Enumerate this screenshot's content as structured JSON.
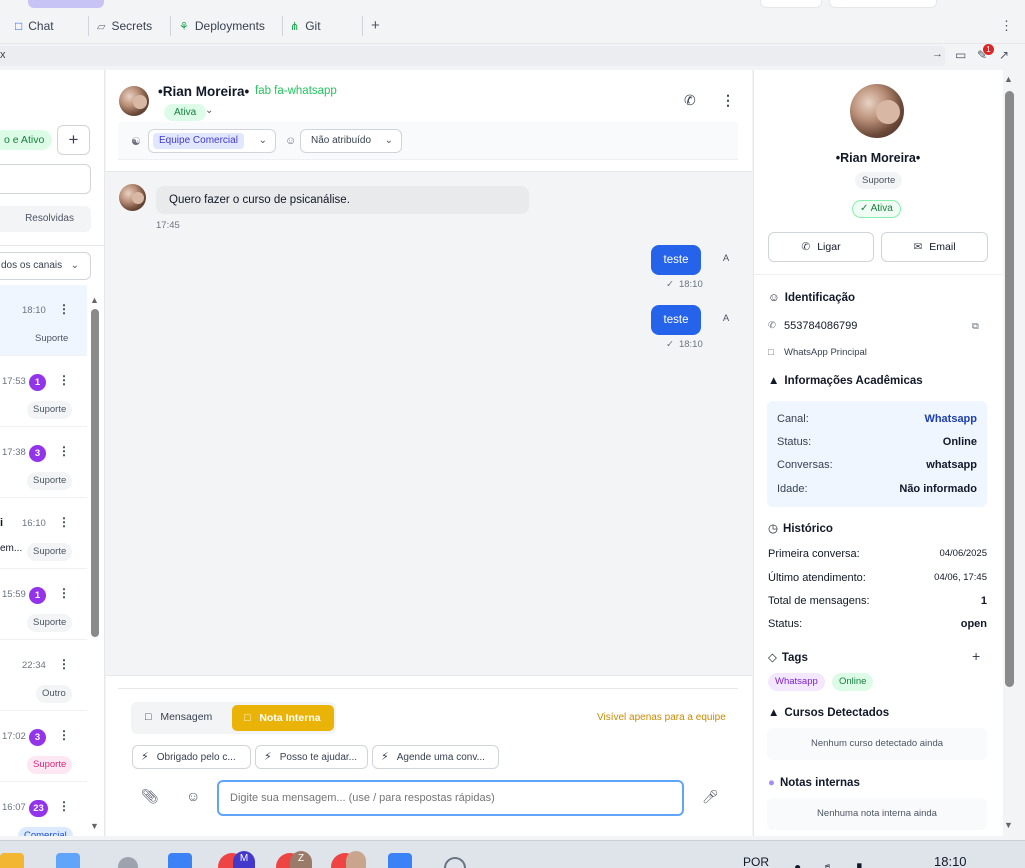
{
  "browser": {
    "tabs": [
      {
        "label": "Chat",
        "icon": "chat-bubble-icon"
      },
      {
        "label": "Secrets",
        "icon": "lock-icon"
      },
      {
        "label": "Deployments",
        "icon": "deploy-icon"
      },
      {
        "label": "Git",
        "icon": "git-branch-icon"
      }
    ],
    "new_tab": "+",
    "address_prefix": "x",
    "notification_count": "1"
  },
  "left": {
    "status_pill": "o e Ativo",
    "add_button": "+",
    "resolved_tab": "Resolvidas",
    "channel_filter": "dos os canais",
    "conversations": [
      {
        "fragment": "",
        "time": "18:10",
        "count": "",
        "tag": "Suporte",
        "tag_style": "gray",
        "active": true
      },
      {
        "fragment": "",
        "time": "17:53",
        "count": "1",
        "tag": "Suporte",
        "tag_style": "gray",
        "active": false
      },
      {
        "fragment": "",
        "time": "17:38",
        "count": "3",
        "tag": "Suporte",
        "tag_style": "gray",
        "active": false
      },
      {
        "fragment": "i",
        "time": "16:10",
        "count": "",
        "tag": "Suporte",
        "tag_style": "gray",
        "active": false,
        "fragment2": "em..."
      },
      {
        "fragment": "",
        "time": "15:59",
        "count": "1",
        "tag": "Suporte",
        "tag_style": "gray",
        "active": false
      },
      {
        "fragment": "",
        "time": "22:34",
        "count": "",
        "tag": "Outro",
        "tag_style": "gray",
        "active": false
      },
      {
        "fragment": "",
        "time": "17:02",
        "count": "3",
        "tag": "Suporte",
        "tag_style": "pink",
        "active": false
      },
      {
        "fragment": "",
        "time": "16:07",
        "count": "23",
        "tag": "Comercial",
        "tag_style": "blue",
        "active": false
      }
    ]
  },
  "chat": {
    "contact_name": "•Rian Moreira•",
    "channel_icon_text": "fab fa-whatsapp",
    "status": "Ativa",
    "team": "Equipe Comercial",
    "assignee": "Não atribuído",
    "messages": [
      {
        "direction": "in",
        "text": "Quero fazer o curso de psicanálise.",
        "time": "17:45"
      },
      {
        "direction": "out",
        "text": "teste",
        "time": "18:10",
        "avatar": "A"
      },
      {
        "direction": "out",
        "text": "teste",
        "time": "18:10",
        "avatar": "A"
      }
    ],
    "composer": {
      "mode_message": "Mensagem",
      "mode_note": "Nota Interna",
      "visibility_note": "Visível apenas para a equipe",
      "quick_replies": [
        "Obrigado pelo c...",
        "Posso te ajudar...",
        "Agende uma conv..."
      ],
      "placeholder": "Digite sua mensagem... (use / para respostas rápidas)"
    }
  },
  "profile": {
    "name": "•Rian Moreira•",
    "department": "Suporte",
    "status": "✓ Ativa",
    "call_button": "Ligar",
    "email_button": "Email",
    "identification_title": "Identificação",
    "phone": "553784086799",
    "channel_name": "WhatsApp Principal",
    "academic_title": "Informações Acadêmicas",
    "academic": [
      {
        "key": "Canal:",
        "value": "Whatsapp",
        "link": true
      },
      {
        "key": "Status:",
        "value": "Online",
        "link": false
      },
      {
        "key": "Conversas:",
        "value": "whatsapp",
        "link": false
      },
      {
        "key": "Idade:",
        "value": "Não informado",
        "link": false
      }
    ],
    "history_title": "Histórico",
    "history": [
      {
        "key": "Primeira conversa:",
        "value": "04/06/2025",
        "bold": false
      },
      {
        "key": "Último atendimento:",
        "value": "04/06, 17:45",
        "bold": false
      },
      {
        "key": "Total de mensagens:",
        "value": "1",
        "bold": true
      },
      {
        "key": "Status:",
        "value": "open",
        "bold": true
      }
    ],
    "tags_title": "Tags",
    "tags": [
      {
        "label": "Whatsapp",
        "bg": "#f3e8ff",
        "fg": "#7e22ce"
      },
      {
        "label": "Online",
        "bg": "#dcfce7",
        "fg": "#15803d"
      }
    ],
    "courses_title": "Cursos Detectados",
    "courses_empty": "Nenhum curso detectado ainda",
    "notes_title": "Notas internas",
    "notes_empty": "Nenhuma nota interna ainda"
  },
  "taskbar": {
    "language": "POR",
    "clock": "18:10",
    "app_letters": [
      "M",
      "Z"
    ]
  }
}
